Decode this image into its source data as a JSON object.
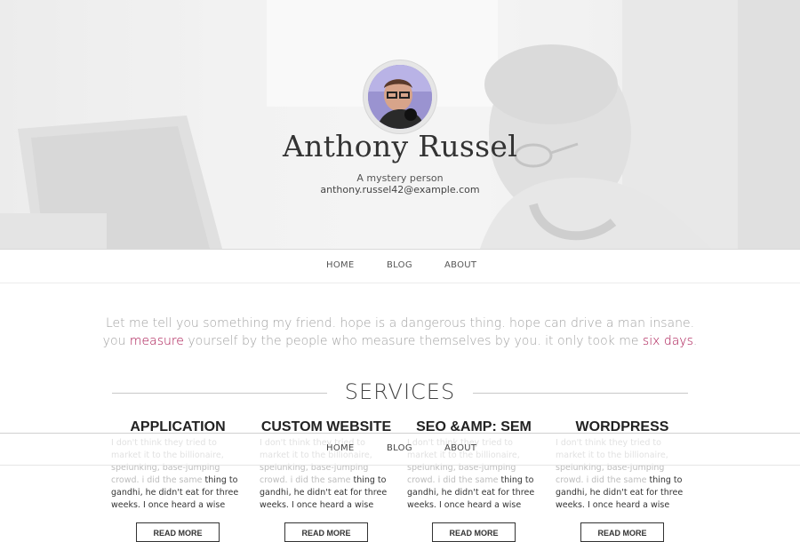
{
  "profile": {
    "name": "Anthony Russel",
    "tagline": "A mystery person",
    "email": "anthony.russel42@example.com"
  },
  "nav": {
    "items": [
      "HOME",
      "BLOG",
      "ABOUT"
    ]
  },
  "quote": {
    "line1": "Let me tell you something my friend. hope is a dangerous thing. hope can drive a man insane.",
    "line2_a": "you ",
    "line2_hl1": "measure",
    "line2_b": " yourself by the people who measure themselves by you. it only took me ",
    "line2_hl2": "six days",
    "line2_c": "."
  },
  "services": {
    "title": "SERVICES",
    "items": [
      {
        "title": "APPLICATION",
        "body_faded": "I don't think they tried to market it to the billionaire, spelunking, base-jumping crowd. i did the same",
        "body": "thing to gandhi, he didn't eat for three weeks. I once heard a wise man say there are no perfect men.",
        "button": "READ MORE"
      },
      {
        "title": "CUSTOM WEBSITE",
        "body_faded": "I don't think they tried to market it to the billionaire, spelunking, base-jumping crowd. i did the same",
        "body": "thing to gandhi, he didn't eat for three weeks. I once heard a wise man say there are no perfect men.",
        "button": "READ MORE"
      },
      {
        "title": "SEO &AMP: SEM",
        "body_faded": "I don't think they tried to market it to the billionaire, spelunking, base-jumping crowd. i did the same",
        "body": "thing to gandhi, he didn't eat for three weeks. I once heard a wise man say there are no perfect men.",
        "button": "READ MORE"
      },
      {
        "title": "WORDPRESS",
        "body_faded": "I don't think they tried to market it to the billionaire, spelunking, base-jumping crowd. i did the same",
        "body": "thing to gandhi, he didn't eat for three weeks. I once heard a wise man say there are no perfect men.",
        "button": "READ MORE"
      }
    ]
  },
  "colors": {
    "accent": "#a8134e",
    "text": "#333333",
    "quote": "#a3a3a3"
  }
}
